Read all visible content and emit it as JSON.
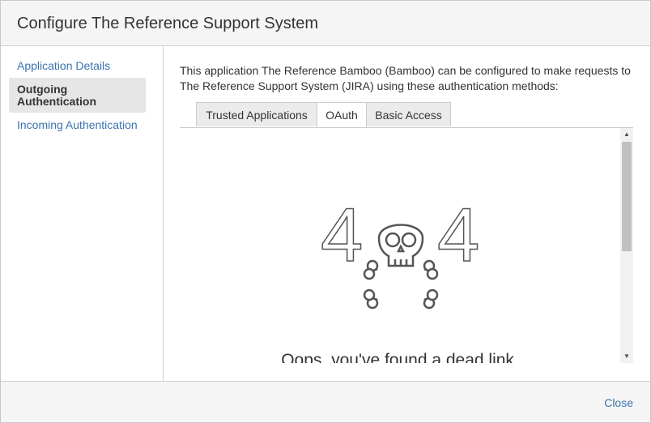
{
  "dialog": {
    "title": "Configure The Reference Support System"
  },
  "sidebar": {
    "items": [
      {
        "label": "Application Details",
        "active": false
      },
      {
        "label_line1": "Outgoing",
        "label_line2": "Authentication",
        "active": true
      },
      {
        "label": "Incoming Authentication",
        "active": false
      }
    ]
  },
  "main": {
    "intro": "This application The Reference Bamboo (Bamboo) can be configured to make requests to The Reference Support System (JIRA) using these authentication methods:",
    "tabs": [
      {
        "label": "Trusted Applications",
        "active": false
      },
      {
        "label": "OAuth",
        "active": true
      },
      {
        "label": "Basic Access",
        "active": false
      }
    ],
    "frame": {
      "error_digit_left": "4",
      "error_digit_right": "4",
      "message": "Oops, you've found a dead link."
    }
  },
  "footer": {
    "close_label": "Close"
  },
  "colors": {
    "link": "#3b73af",
    "text": "#333333",
    "header_bg": "#f5f5f5",
    "active_nav_bg": "#e6e6e6",
    "tab_bg": "#ebebeb",
    "art_stroke": "#555555"
  }
}
